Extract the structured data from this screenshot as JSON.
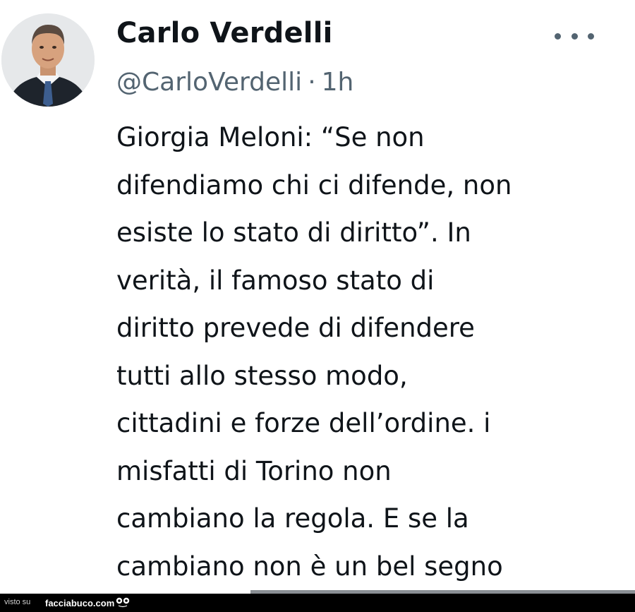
{
  "author": {
    "display_name": "Carlo Verdelli",
    "handle": "@CarloVerdelli",
    "separator": "·",
    "time": "1h",
    "avatar_icon": "profile-photo"
  },
  "tweet": {
    "lines": [
      "Giorgia Meloni: “Se non",
      "difendiamo chi ci difende, non",
      "esiste lo stato di diritto”. In",
      "verità, il famoso stato di",
      "diritto prevede di difendere",
      "tutti allo stesso modo,",
      "cittadini e forze dell’ordine. i",
      "misfatti di Torino non",
      "cambiano la regola. E se la",
      "cambiano non è un bel segno"
    ]
  },
  "more_menu": {
    "icon": "more-horizontal-icon"
  },
  "watermark": {
    "prefix": "visto su",
    "site": "facciabuco.com"
  },
  "colors": {
    "text": "#0f1419",
    "secondary": "#536471",
    "watermark_bg": "#000000"
  }
}
